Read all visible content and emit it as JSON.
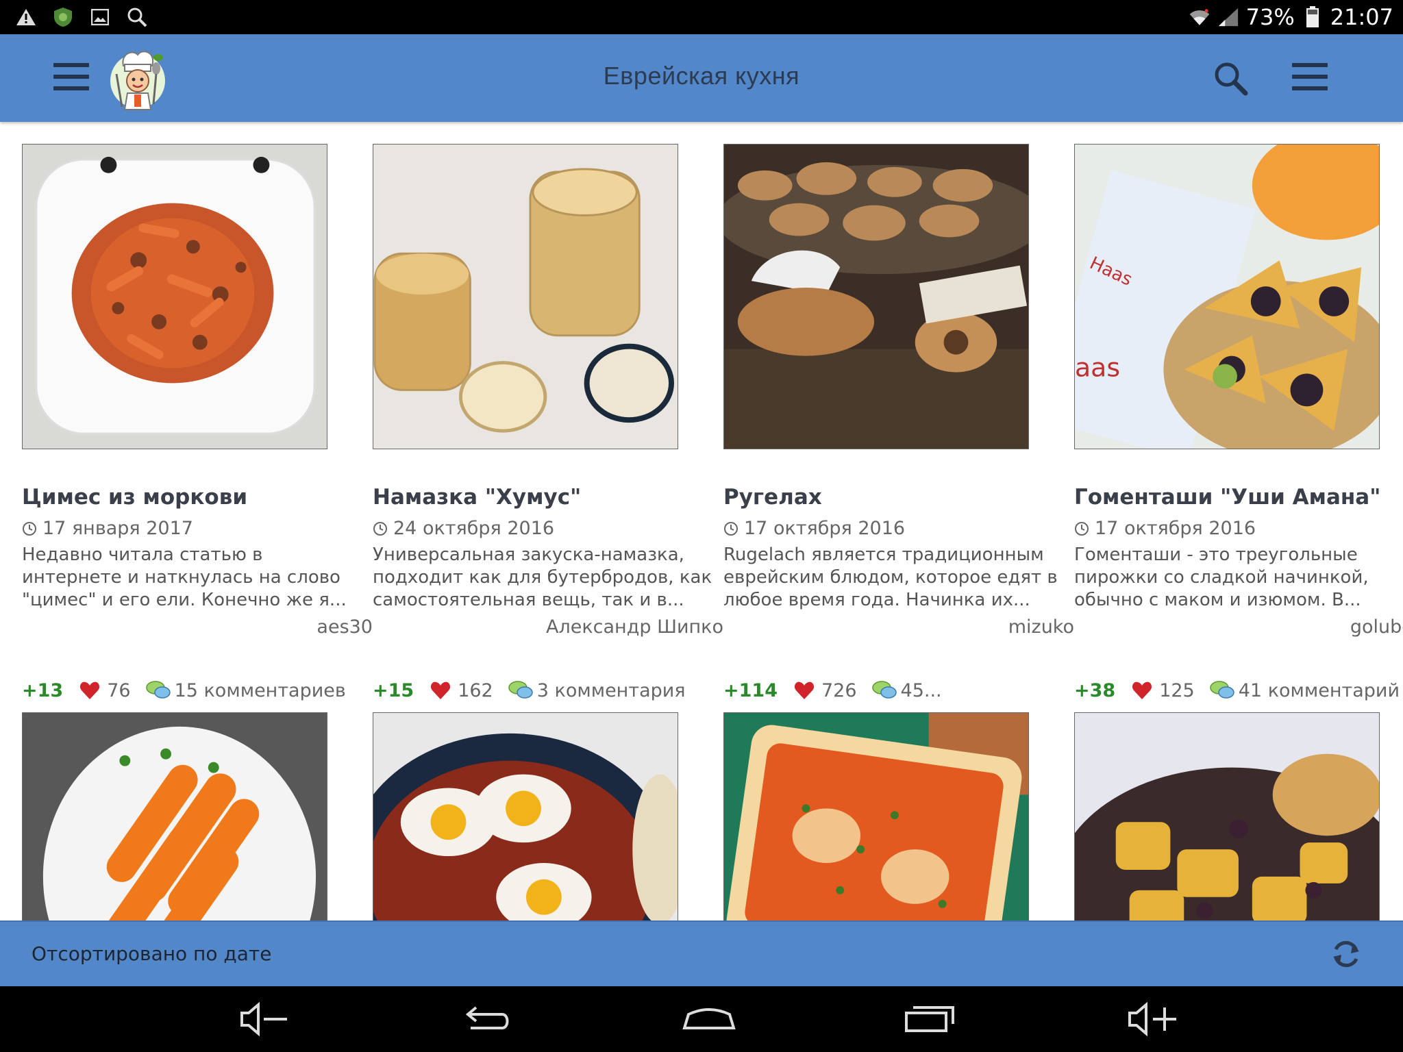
{
  "status_bar": {
    "battery": "73%",
    "time": "21:07"
  },
  "app_bar": {
    "title": "Еврейская кухня"
  },
  "cards": [
    {
      "title": "Цимес из моркови",
      "date": "17 января 2017",
      "excerpt": "Недавно читала статью в интернете и наткнулась на слово \"цимес\" и его ели. Конечно же я...",
      "author": "aes30",
      "rating": "+13",
      "likes": "76",
      "comments": "15 комментариев"
    },
    {
      "title": "Намазка \"Хумус\"",
      "date": "24 октября 2016",
      "excerpt": "Универсальная закуска-намазка, подходит как для бутербродов, как самостоятельная вещь, так и в...",
      "author": "Александр Шипко",
      "rating": "+15",
      "likes": "162",
      "comments": "3 комментария"
    },
    {
      "title": "Ругелах",
      "date": "17 октября 2016",
      "excerpt": "Rugelach является традиционным еврейским блюдом, которое едят в любое время года. Начинка их...",
      "author": "mizuko",
      "rating": "+114",
      "likes": "726",
      "comments": "45..."
    },
    {
      "title": "Гоменташи \"Уши Амана\"",
      "date": "17 октября 2016",
      "excerpt": "Гоменташи - это треугольные пирожки со сладкой начинкой, обычно с маком и изюмом. В...",
      "author": "golubga",
      "rating": "+38",
      "likes": "125",
      "comments": "41 комментарий"
    },
    {
      "title": "",
      "date": "",
      "excerpt": "",
      "author": "",
      "rating": "",
      "likes": "",
      "comments": ""
    },
    {
      "title": "",
      "date": "",
      "excerpt": "",
      "author": "",
      "rating": "",
      "likes": "",
      "comments": ""
    },
    {
      "title": "",
      "date": "",
      "excerpt": "",
      "author": "",
      "rating": "",
      "likes": "",
      "comments": ""
    },
    {
      "title": "",
      "date": "",
      "excerpt": "",
      "author": "",
      "rating": "",
      "likes": "",
      "comments": ""
    }
  ],
  "sort_bar": {
    "label": "Отсортировано по дате"
  },
  "icons": {
    "status_left": [
      "warning-icon",
      "shield-app-icon",
      "gallery-icon",
      "search-icon"
    ],
    "status_right": [
      "wifi-icon",
      "signal-icon",
      "battery-icon"
    ],
    "nav": [
      "volume-down-icon",
      "back-icon",
      "home-icon",
      "recents-icon",
      "volume-up-icon"
    ]
  },
  "colors": {
    "app_bar": "#5288c9",
    "rating_green": "#2a8a2a",
    "heart_red": "#d0232a"
  }
}
